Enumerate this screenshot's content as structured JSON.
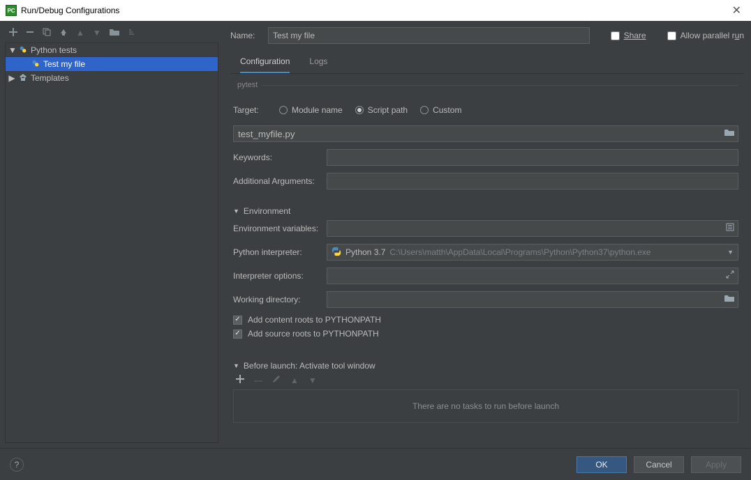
{
  "window": {
    "title": "Run/Debug Configurations"
  },
  "tree": {
    "groups": [
      {
        "label": "Python tests",
        "expanded": true,
        "items": [
          {
            "label": "Test my file",
            "selected": true
          }
        ]
      },
      {
        "label": "Templates",
        "expanded": false,
        "items": []
      }
    ]
  },
  "header": {
    "name_label": "Name:",
    "name_value": "Test my file",
    "share_label": "Share",
    "parallel_label": "Allow parallel run"
  },
  "tabs": [
    {
      "label": "Configuration",
      "active": true
    },
    {
      "label": "Logs",
      "active": false
    }
  ],
  "pytest": {
    "legend": "pytest",
    "target_label": "Target:",
    "target_options": [
      {
        "label": "Module name",
        "selected": false
      },
      {
        "label": "Script path",
        "selected": true
      },
      {
        "label": "Custom",
        "selected": false
      }
    ],
    "script_path_value": "test_myfile.py",
    "keywords_label": "Keywords:",
    "keywords_value": "",
    "additional_args_label": "Additional Arguments:",
    "additional_args_value": ""
  },
  "environment": {
    "legend": "Environment",
    "env_vars_label": "Environment variables:",
    "env_vars_value": "",
    "interpreter_label": "Python interpreter:",
    "interpreter_name": "Python 3.7",
    "interpreter_path": "C:\\Users\\matth\\AppData\\Local\\Programs\\Python\\Python37\\python.exe",
    "interpreter_options_label": "Interpreter options:",
    "interpreter_options_value": "",
    "working_dir_label": "Working directory:",
    "working_dir_value": "",
    "add_content_roots_label": "Add content roots to PYTHONPATH",
    "add_content_roots_checked": true,
    "add_source_roots_label": "Add source roots to PYTHONPATH",
    "add_source_roots_checked": true
  },
  "before_launch": {
    "legend": "Before launch: Activate tool window",
    "empty_text": "There are no tasks to run before launch"
  },
  "footer": {
    "ok": "OK",
    "cancel": "Cancel",
    "apply": "Apply"
  }
}
